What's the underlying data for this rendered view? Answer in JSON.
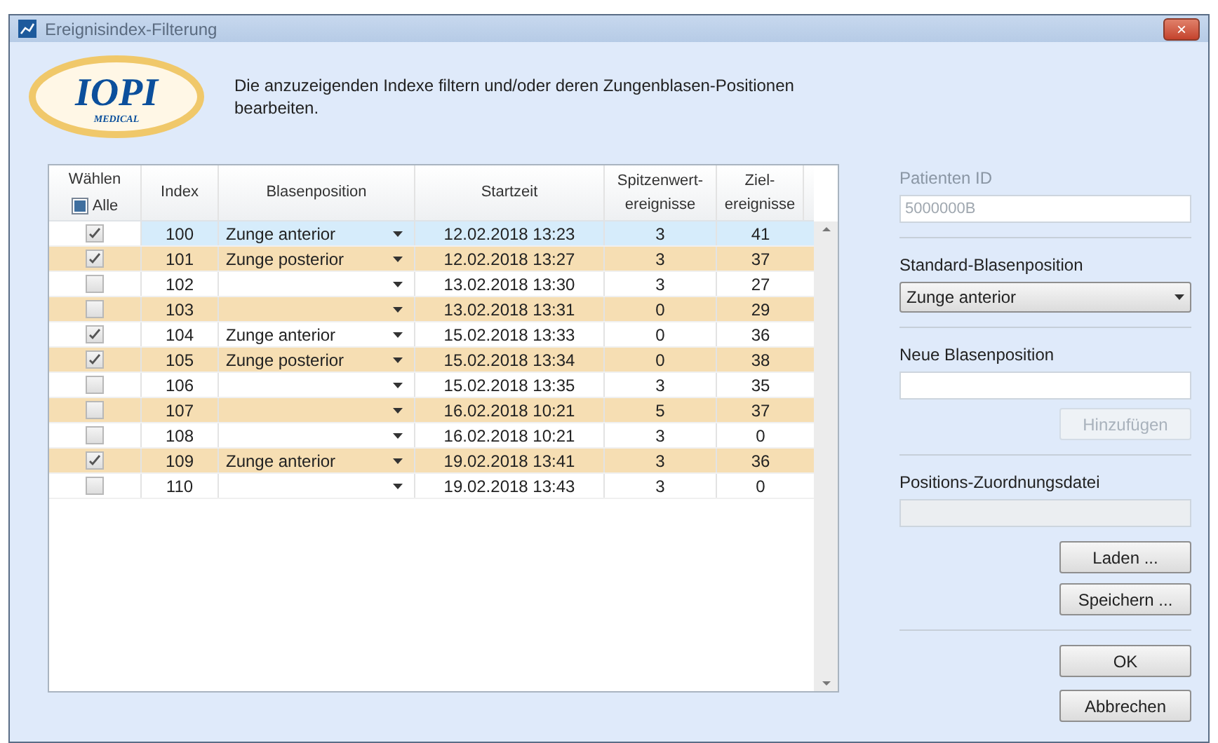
{
  "window": {
    "title": "Ereignisindex-Filterung",
    "close": "×"
  },
  "logo": {
    "name": "IOPI",
    "sub": "MEDICAL"
  },
  "instruction": "Die anzuzeigenden Indexe filtern und/oder deren Zungenblasen-Positionen bearbeiten.",
  "table": {
    "columns": [
      "Wählen",
      "Index",
      "Blasenposition",
      "Startzeit",
      "Spitzenwert-ereignisse",
      "Ziel-ereignisse"
    ],
    "select_all": {
      "label": "Alle",
      "indeterminate": true
    },
    "rows": [
      {
        "checked": true,
        "index": "100",
        "position": "Zunge anterior",
        "start": "12.02.2018 13:23",
        "peaks": "3",
        "targets": "41",
        "selected": true
      },
      {
        "checked": true,
        "index": "101",
        "position": "Zunge posterior",
        "start": "12.02.2018 13:27",
        "peaks": "3",
        "targets": "37",
        "selected": false
      },
      {
        "checked": false,
        "index": "102",
        "start": "13.02.2018 13:30",
        "peaks": "3",
        "targets": "27",
        "selected": false
      },
      {
        "checked": false,
        "index": "103",
        "start": "13.02.2018 13:31",
        "peaks": "0",
        "targets": "29",
        "selected": false
      },
      {
        "checked": true,
        "index": "104",
        "position": "Zunge anterior",
        "start": "15.02.2018 13:33",
        "peaks": "0",
        "targets": "36",
        "selected": false
      },
      {
        "checked": true,
        "index": "105",
        "position": "Zunge posterior",
        "start": "15.02.2018 13:34",
        "peaks": "0",
        "targets": "38",
        "selected": false
      },
      {
        "checked": false,
        "index": "106",
        "start": "15.02.2018 13:35",
        "peaks": "3",
        "targets": "35",
        "selected": false
      },
      {
        "checked": false,
        "index": "107",
        "start": "16.02.2018 10:21",
        "peaks": "5",
        "targets": "37",
        "selected": false
      },
      {
        "checked": false,
        "index": "108",
        "start": "16.02.2018 10:21",
        "peaks": "3",
        "targets": "0",
        "selected": false
      },
      {
        "checked": true,
        "index": "109",
        "position": "Zunge anterior",
        "start": "19.02.2018 13:41",
        "peaks": "3",
        "targets": "36",
        "selected": false
      },
      {
        "checked": false,
        "index": "110",
        "start": "19.02.2018 13:43",
        "peaks": "3",
        "targets": "0",
        "selected": false
      }
    ]
  },
  "patient_id": {
    "label": "Patienten ID",
    "value": "5000000B",
    "disabled": true
  },
  "default_position": {
    "label": "Standard-Blasenposition",
    "value": "Zunge anterior"
  },
  "new_position": {
    "label": "Neue Blasenposition",
    "button": {
      "label": "Hinzufügen",
      "disabled": true
    }
  },
  "mapping_file": {
    "label": "Positions-Zuordnungsdatei",
    "disabled": true
  },
  "file_buttons": [
    "Laden ...",
    "Speichern ..."
  ],
  "dialog_buttons": [
    "OK",
    "Abbrechen"
  ]
}
